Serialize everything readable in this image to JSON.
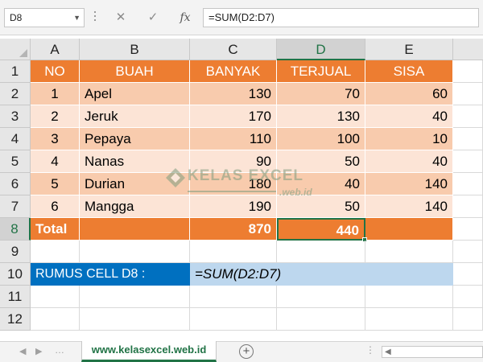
{
  "formula_bar": {
    "name_box": "D8",
    "cancel_icon": "✕",
    "enter_icon": "✓",
    "fx_label": "fx",
    "formula": "=SUM(D2:D7)"
  },
  "columns": [
    "A",
    "B",
    "C",
    "D",
    "E"
  ],
  "rows": [
    "1",
    "2",
    "3",
    "4",
    "5",
    "6",
    "7",
    "8",
    "9",
    "10",
    "11",
    "12"
  ],
  "table": {
    "headers": [
      "NO",
      "BUAH",
      "BANYAK",
      "TERJUAL",
      "SISA"
    ],
    "data": [
      {
        "no": "1",
        "buah": "Apel",
        "banyak": "130",
        "terjual": "70",
        "sisa": "60"
      },
      {
        "no": "2",
        "buah": "Jeruk",
        "banyak": "170",
        "terjual": "130",
        "sisa": "40"
      },
      {
        "no": "3",
        "buah": "Pepaya",
        "banyak": "110",
        "terjual": "100",
        "sisa": "10"
      },
      {
        "no": "4",
        "buah": "Nanas",
        "banyak": "90",
        "terjual": "50",
        "sisa": "40"
      },
      {
        "no": "5",
        "buah": "Durian",
        "banyak": "180",
        "terjual": "40",
        "sisa": "140"
      },
      {
        "no": "6",
        "buah": "Mangga",
        "banyak": "190",
        "terjual": "50",
        "sisa": "140"
      }
    ],
    "total": {
      "label": "Total",
      "banyak": "870",
      "terjual": "440"
    }
  },
  "formula_note": {
    "label": "RUMUS CELL D8 :",
    "formula": "=SUM(D2:D7)"
  },
  "watermark": {
    "title": "KELAS EXCEL",
    "sub": ".web.id"
  },
  "sheet_tabs": {
    "active": "www.kelasexcel.web.id",
    "add_icon": "+"
  },
  "colors": {
    "header": "#ed7d31",
    "band_dark": "#f8cbad",
    "band_light": "#fce4d6",
    "note_label": "#0070c0",
    "note_value": "#bdd7ee",
    "selection": "#217346"
  }
}
